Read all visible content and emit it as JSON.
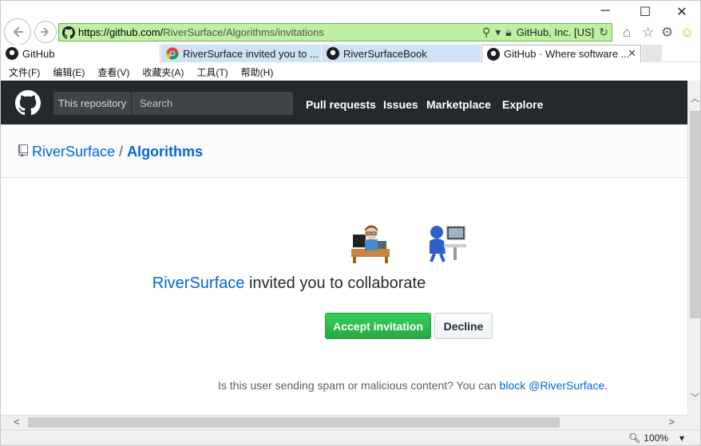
{
  "window": {
    "minimize": "─",
    "maximize": "☐",
    "close": "✕"
  },
  "address": {
    "url_host": "https://github.com/",
    "url_path": "RiverSurface/Algorithms/invitations",
    "cert_label": "GitHub, Inc. [US]"
  },
  "tabs": [
    {
      "label": "GitHub",
      "icon": "github-icon"
    },
    {
      "label": "RiverSurface invited you to ...",
      "icon": "chrome-icon"
    },
    {
      "label": "RiverSurfaceBook",
      "icon": "github-icon"
    },
    {
      "label": "GitHub · Where software ...",
      "icon": "github-icon",
      "active": true
    }
  ],
  "menu": [
    "文件(F)",
    "编辑(E)",
    "查看(V)",
    "收藏夹(A)",
    "工具(T)",
    "帮助(H)"
  ],
  "gh_header": {
    "scope": "This repository",
    "search_placeholder": "Search",
    "nav": [
      "Pull requests",
      "Issues",
      "Marketplace",
      "Explore"
    ]
  },
  "repo": {
    "owner": "RiverSurface",
    "separator": "/",
    "name": "Algorithms"
  },
  "invite": {
    "user": "RiverSurface",
    "text": " invited you to collaborate",
    "accept": "Accept invitation",
    "decline": "Decline"
  },
  "spam": {
    "prefix": "Is this user sending spam or malicious content? You can ",
    "link": "block @RiverSurface",
    "suffix": "."
  },
  "status": {
    "zoom": "100%"
  },
  "colors": {
    "header_bg": "#24292e",
    "link": "#0366d6",
    "accept": "#28a745",
    "address_secure": "#bdf0a1"
  }
}
